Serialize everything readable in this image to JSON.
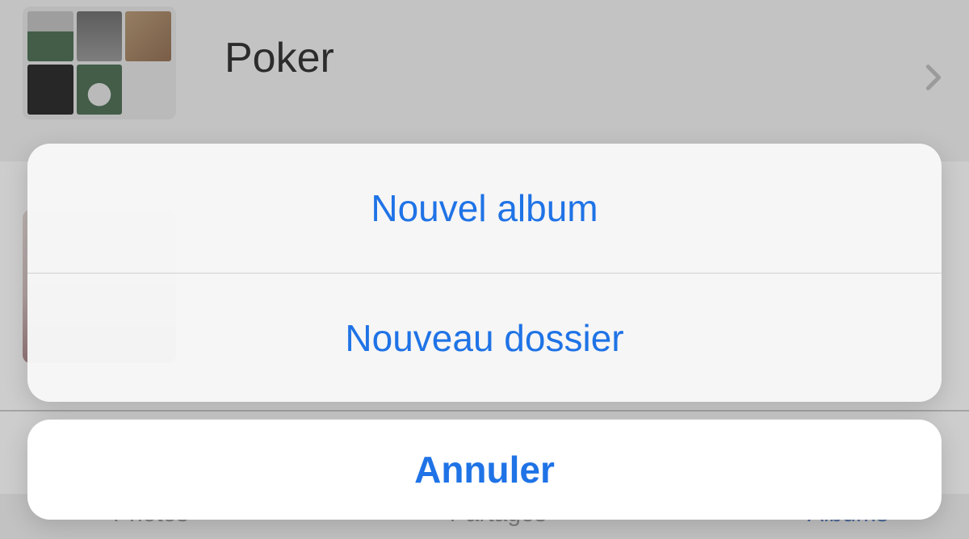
{
  "background": {
    "album_title": "Poker"
  },
  "toolbar": {
    "photos": "Photos",
    "shared": "Partagés",
    "albums": "Albums"
  },
  "action_sheet": {
    "new_album": "Nouvel album",
    "new_folder": "Nouveau dossier",
    "cancel": "Annuler"
  },
  "colors": {
    "accent": "#1f73e6"
  }
}
